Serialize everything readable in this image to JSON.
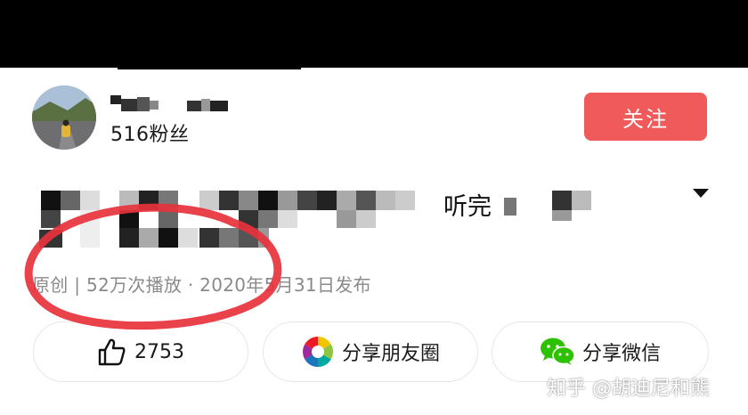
{
  "profile": {
    "fans": "516粉丝",
    "follow_label": "关注"
  },
  "video": {
    "title_visible_fragment": "听完",
    "meta": "原创 | 52万次播放 · 2020年5月31日发布"
  },
  "actions": {
    "like_count": "2753",
    "moments_label": "分享朋友圈",
    "wechat_label": "分享微信"
  },
  "watermark": "知乎 @胡迪尼和熊",
  "colors": {
    "follow_button": "#f05a5a",
    "annotation": "#e8323c",
    "meta_text": "#8a8a8a",
    "wechat_green": "#2dc100"
  },
  "icons": {
    "like": "thumbs-up-icon",
    "moments": "wechat-moments-icon",
    "wechat": "wechat-icon",
    "expand": "chevron-down-icon"
  }
}
